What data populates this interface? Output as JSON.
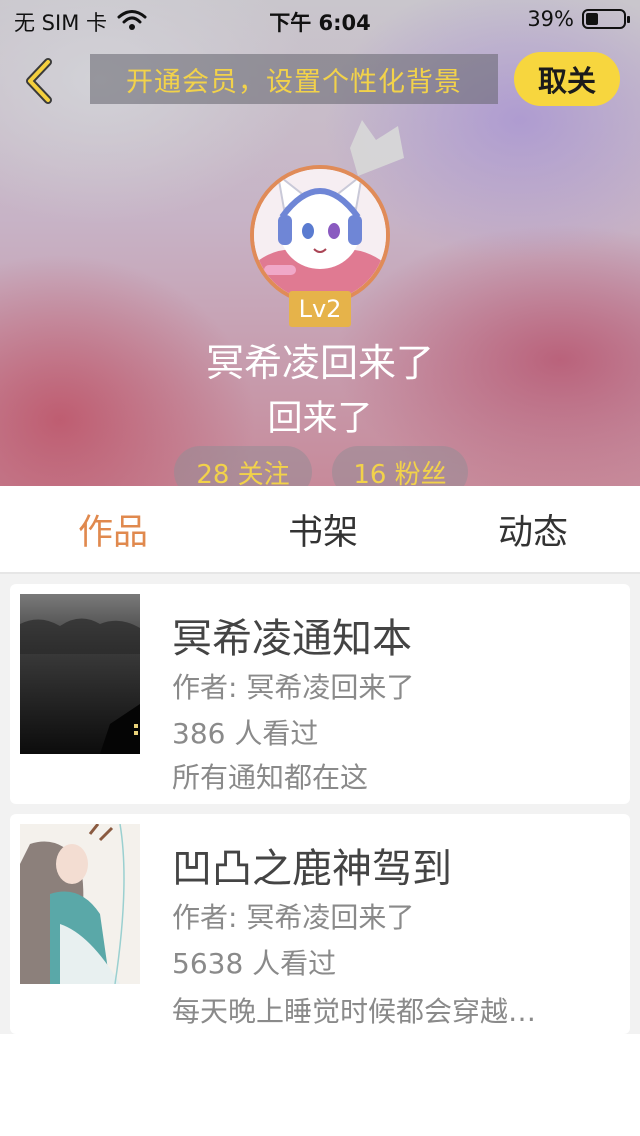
{
  "status_bar": {
    "carrier": "无 SIM 卡",
    "time": "下午 6:04",
    "battery": "39%"
  },
  "nav": {
    "vip_banner": "开通会员，设置个性化背景",
    "unfollow_label": "取关"
  },
  "profile": {
    "level": "Lv2",
    "nickname": "冥希凌回来了",
    "signature": "回来了",
    "following": "28 关注",
    "fans": "16 粉丝"
  },
  "tabs": [
    {
      "label": "作品",
      "active": true
    },
    {
      "label": "书架",
      "active": false
    },
    {
      "label": "动态",
      "active": false
    }
  ],
  "works": [
    {
      "title": "冥希凌通知本",
      "author": "作者: 冥希凌回来了",
      "views": "386 人看过",
      "description": "所有通知都在这"
    },
    {
      "title": "凹凸之鹿神驾到",
      "author": "作者: 冥希凌回来了",
      "views": "5638 人看过",
      "description": "每天晚上睡觉时候都会穿越…"
    }
  ],
  "colors": {
    "accent": "#e0894e",
    "yellow": "#f7d63e",
    "level_badge": "#e6b34a"
  },
  "icons": [
    "back-arrow-icon",
    "wifi-icon",
    "battery-icon",
    "crown-icon"
  ]
}
